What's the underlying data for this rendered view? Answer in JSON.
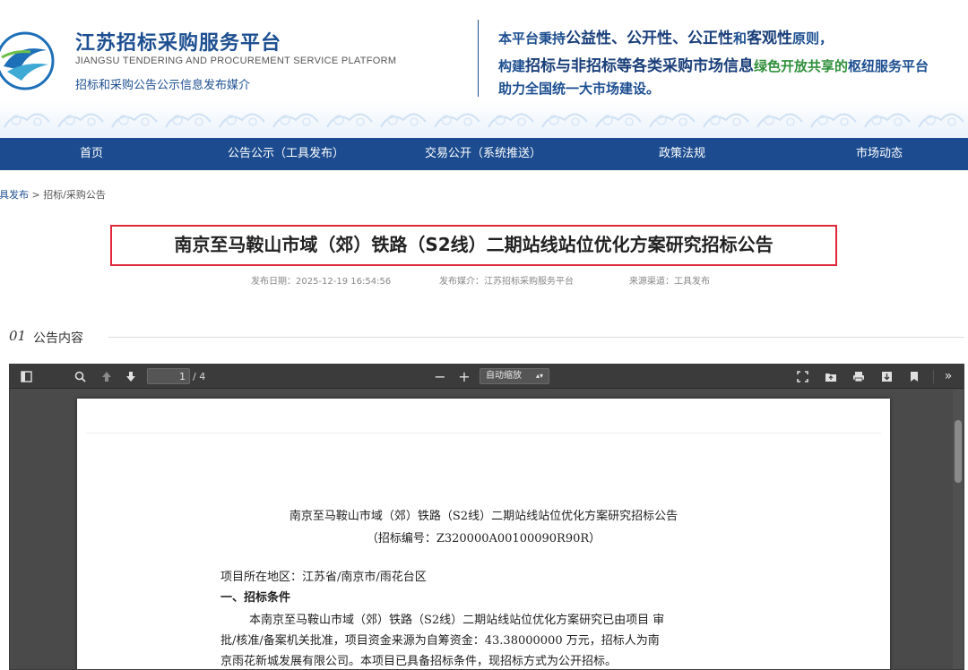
{
  "header": {
    "title": "江苏招标采购服务平台",
    "title_en": "JIANGSU TENDERING AND PROCUREMENT SERVICE PLATFORM",
    "subtitle": "招标和采购公告公示信息发布媒介",
    "slogan": {
      "l1_a": "本平台秉持",
      "l1_b": "公益性、公开性、公正性",
      "l1_c": "和",
      "l1_d": "客观性",
      "l1_e": "原则，",
      "l2_a": "构建",
      "l2_b": "招标与非招标等各类采购市场信息",
      "l2_c": "绿色开放共享的",
      "l2_d": "枢纽服务平台",
      "l3": "助力全国统一大市场建设。"
    }
  },
  "nav": {
    "items": [
      "首页",
      "公告公示（工具发布）",
      "交易公开（系统推送）",
      "政策法规",
      "市场动态"
    ]
  },
  "breadcrumb": {
    "link": "工具发布",
    "sep": " > ",
    "current": "招标/采购公告"
  },
  "article": {
    "title": "南京至马鞍山市域（郊）铁路（S2线）二期站线站位优化方案研究招标公告",
    "publish_date": "发布日期：2025-12-19 16:54:56",
    "media": "发布媒介：江苏招标采购服务平台",
    "source": "来源渠道：工具发布"
  },
  "section": {
    "num": "01",
    "label": "公告内容"
  },
  "viewer": {
    "page_current": "1",
    "page_total": "/ 4",
    "zoom": "自动缩放",
    "doc": {
      "title": "南京至马鞍山市域（郊）铁路（S2线）二期站线站位优化方案研究招标公告",
      "code": "（招标编号：Z320000A00100090R90R）",
      "region": "项目所在地区：江苏省/南京市/雨花台区",
      "heading": "一、招标条件",
      "p1": "本南京至马鞍山市域（郊）铁路（S2线）二期站线站位优化方案研究已由项目 审",
      "p2": "批/核准/备案机关批准，项目资金来源为自筹资金：43.38000000 万元，招标人为南",
      "p3": "京雨花新城发展有限公司。本项目已具备招标条件，现招标方式为公开招标。"
    }
  },
  "colors": {
    "brand_blue": "#1d4f91",
    "nav_bg": "#1c4c8f",
    "highlight_red": "#e0283a",
    "slogan_green": "#2f8f3a"
  }
}
